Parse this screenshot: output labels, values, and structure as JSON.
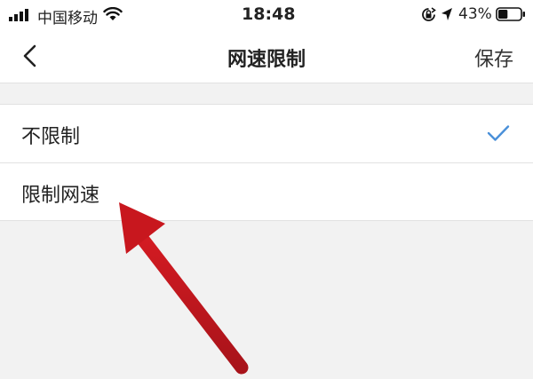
{
  "status_bar": {
    "carrier": "中国移动",
    "time": "18:48",
    "battery_percent": "43%",
    "battery_level": 0.43,
    "icons": [
      "signal-icon",
      "wifi-icon",
      "orientation-lock-icon",
      "location-icon",
      "battery-icon"
    ]
  },
  "nav": {
    "back_icon": "chevron-left-icon",
    "title": "网速限制",
    "save_label": "保存"
  },
  "options": [
    {
      "label": "不限制",
      "selected": true
    },
    {
      "label": "限制网速",
      "selected": false
    }
  ],
  "colors": {
    "accent": "#4a90d9",
    "annotation_arrow": "#c0161c",
    "background": "#f2f2f2"
  }
}
